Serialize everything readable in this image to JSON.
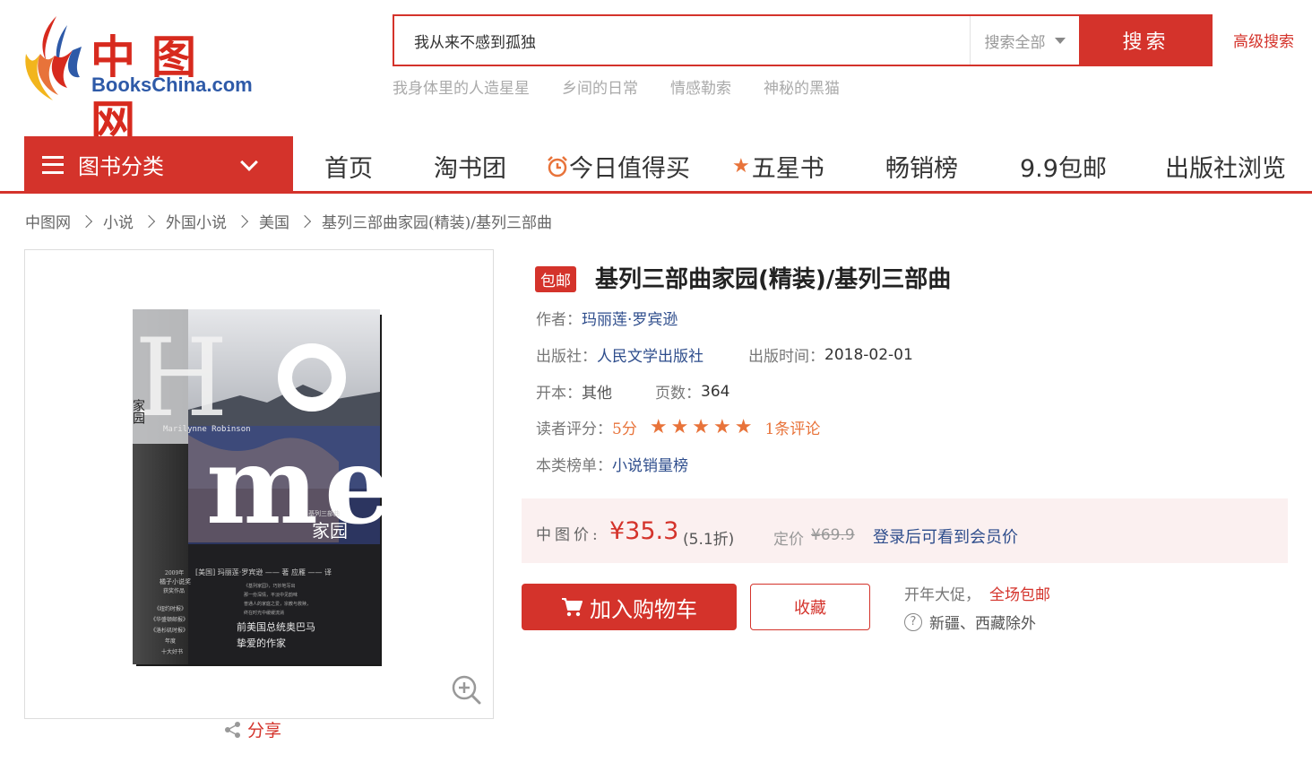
{
  "header": {
    "logo_cn": "中图网",
    "logo_en": "BooksChina.com",
    "search_value": "我从来不感到孤独",
    "search_scope": "搜索全部",
    "search_button": "搜索",
    "advanced_search": "高级搜索",
    "hot_words": [
      "我身体里的人造星星",
      "乡间的日常",
      "情感勒索",
      "神秘的黑猫"
    ]
  },
  "nav": {
    "category_label": "图书分类",
    "items": [
      {
        "label": "首页",
        "icon": ""
      },
      {
        "label": "淘书团",
        "icon": ""
      },
      {
        "label": "今日值得买",
        "icon": "alarm-clock-icon"
      },
      {
        "label": "五星书",
        "icon": "star-icon"
      },
      {
        "label": "畅销榜",
        "icon": ""
      },
      {
        "label": "9.9包邮",
        "icon": ""
      },
      {
        "label": "出版社浏览",
        "icon": ""
      }
    ]
  },
  "breadcrumb": [
    "中图网",
    "小说",
    "外国小说",
    "美国",
    "基列三部曲家园(精装)/基列三部曲"
  ],
  "product": {
    "badge": "包邮",
    "title": "基列三部曲家园(精装)/基列三部曲",
    "author_label": "作者：",
    "author": "玛丽莲·罗宾逊",
    "publisher_label": "出版社：",
    "publisher": "人民文学出版社",
    "pubdate_label": "出版时间：",
    "pubdate": "2018-02-01",
    "format_label": "开本：",
    "format": "其他",
    "pages_label": "页数：",
    "pages": "364",
    "rating_label": "读者评分：",
    "rating": "5分",
    "rating_stars": 5,
    "reviews": "1条评论",
    "rank_label": "本类榜单：",
    "rank": "小说销量榜",
    "price_label": "中图价:",
    "price": "¥35.3",
    "discount": "(5.1折)",
    "list_price_label": "定价",
    "list_price": "¥69.9",
    "member_note": "登录后可看到会员价",
    "add_to_cart": "加入购物车",
    "favorite": "收藏",
    "promo_text": "开年大促，",
    "promo_highlight": "全场包邮",
    "shipping_note": "新疆、西藏除外",
    "share": "分享"
  },
  "cover": {
    "big_text": "Home",
    "author_en": "Marilynne Robinson",
    "title_cn": "家园",
    "series_cn": "基列三部曲",
    "translator_line": "[美国] 玛丽莲·罗宾逊 —— 著   应雁 —— 译",
    "award_lines": [
      "2009年",
      "橘子小说奖",
      "获奖作品"
    ],
    "media_lines": [
      "《纽约时报》",
      "《华盛顿邮报》",
      "《洛杉矶时报》",
      "年度",
      "十大好书"
    ],
    "quote_lines": [
      "前美国总统奥巴马",
      "挚爱的作家"
    ],
    "blurb_lines": [
      "《基列家园》，巧妙地写出",
      "那一份深情，平淡中见韵味",
      "普通人的家庭之爱，宗教与救赎，",
      "终在时光中缓缓流淌"
    ]
  }
}
